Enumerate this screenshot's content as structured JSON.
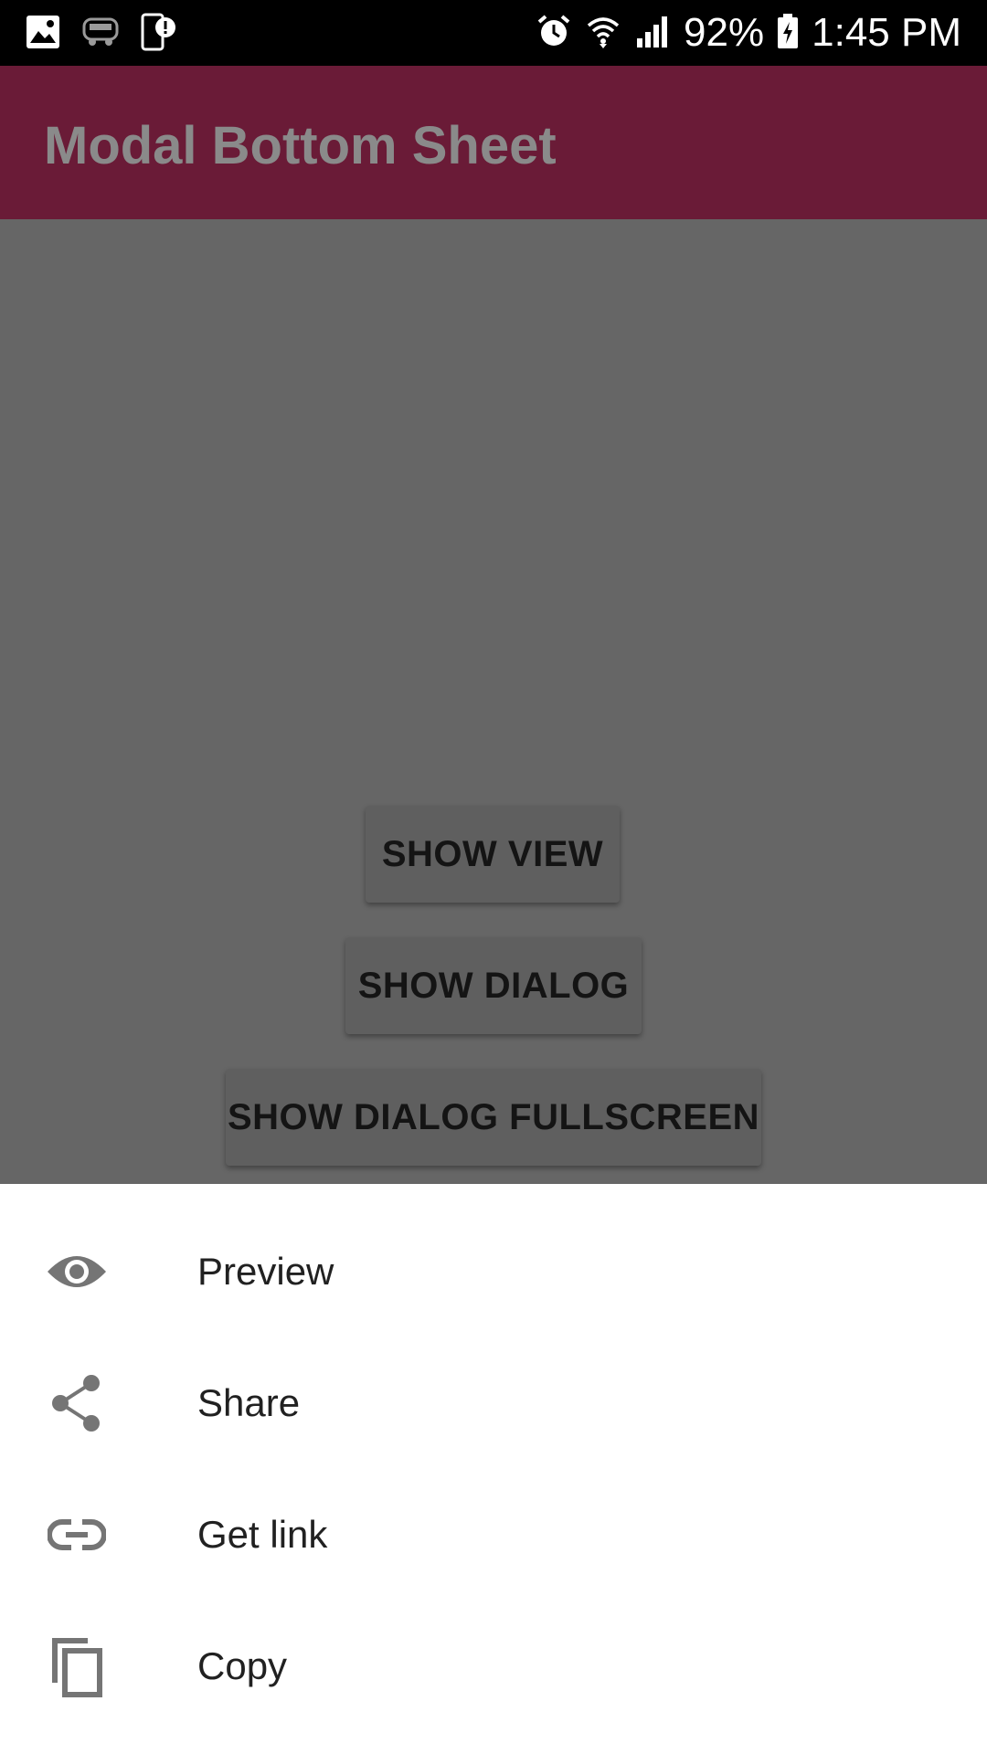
{
  "status_bar": {
    "battery": "92%",
    "time": "1:45 PM",
    "left_icons": [
      "image-icon",
      "redbus-icon",
      "phone-alert-icon"
    ],
    "right_icons": [
      "alarm-icon",
      "wifi-icon",
      "signal-icon",
      "battery-charging-icon"
    ]
  },
  "app_bar": {
    "title": "Modal Bottom Sheet",
    "color": "#6a1b37"
  },
  "content": {
    "buttons": [
      {
        "label": "SHOW VIEW"
      },
      {
        "label": "SHOW DIALOG"
      },
      {
        "label": "SHOW DIALOG FULLSCREEN"
      }
    ]
  },
  "bottom_sheet": {
    "items": [
      {
        "label": "Preview",
        "icon": "eye-icon"
      },
      {
        "label": "Share",
        "icon": "share-icon"
      },
      {
        "label": "Get link",
        "icon": "link-icon"
      },
      {
        "label": "Copy",
        "icon": "copy-icon"
      }
    ]
  }
}
